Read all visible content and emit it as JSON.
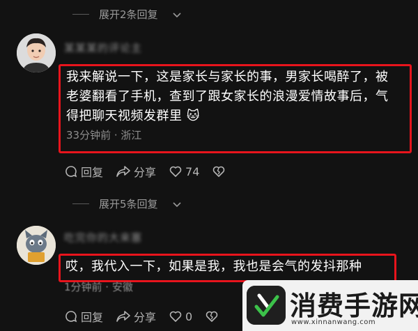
{
  "thread": {
    "expand_top_label": "展开2条回复",
    "expand_mid_label": "展开5条回复"
  },
  "comment1": {
    "username": "某某某的评论主",
    "text_lines": [
      "我来解说一下，这是家长与家长的事，男家长喝醉了，被",
      "老婆翻看了手机，查到了跟女家长的浪漫爱情故事后，气",
      "得把聊天视频发群里 🐱"
    ],
    "meta": "33分钟前 · 浙江",
    "reply_label": "回复",
    "share_label": "分享",
    "like_count": "74"
  },
  "comment2": {
    "username": "吃完你的大来塞",
    "text": "哎，我代入一下，如果是我，我也是会气的发抖那种",
    "meta": "1分钟前 · 安徽",
    "reply_label": "回复",
    "share_label": "分享",
    "like_count": "0"
  },
  "watermark": {
    "title": "消费手游网",
    "url": "www.xinnanwang.com"
  },
  "colors": {
    "background": "#121212",
    "highlight_border": "#e8141c",
    "secondary_text": "#8e8e8e"
  }
}
